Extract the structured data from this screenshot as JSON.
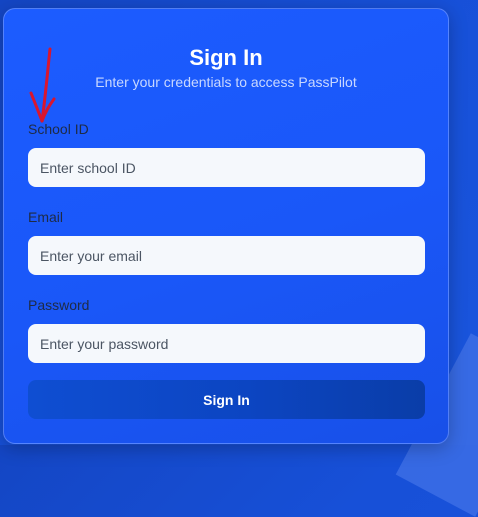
{
  "colors": {
    "page_background": "#1750d8",
    "card_background": "#1c5cff",
    "input_background": "#f5f8fc",
    "button_background": "#0c45c2",
    "annotation": "#d9162e"
  },
  "signin": {
    "title": "Sign In",
    "subtitle": "Enter your credentials to access PassPilot",
    "fields": {
      "school_id": {
        "label": "School ID",
        "placeholder": "Enter school ID",
        "value": ""
      },
      "email": {
        "label": "Email",
        "placeholder": "Enter your email",
        "value": ""
      },
      "password": {
        "label": "Password",
        "placeholder": "Enter your password",
        "value": ""
      }
    },
    "submit_label": "Sign In"
  },
  "annotation": {
    "icon": "down-arrow-icon"
  }
}
